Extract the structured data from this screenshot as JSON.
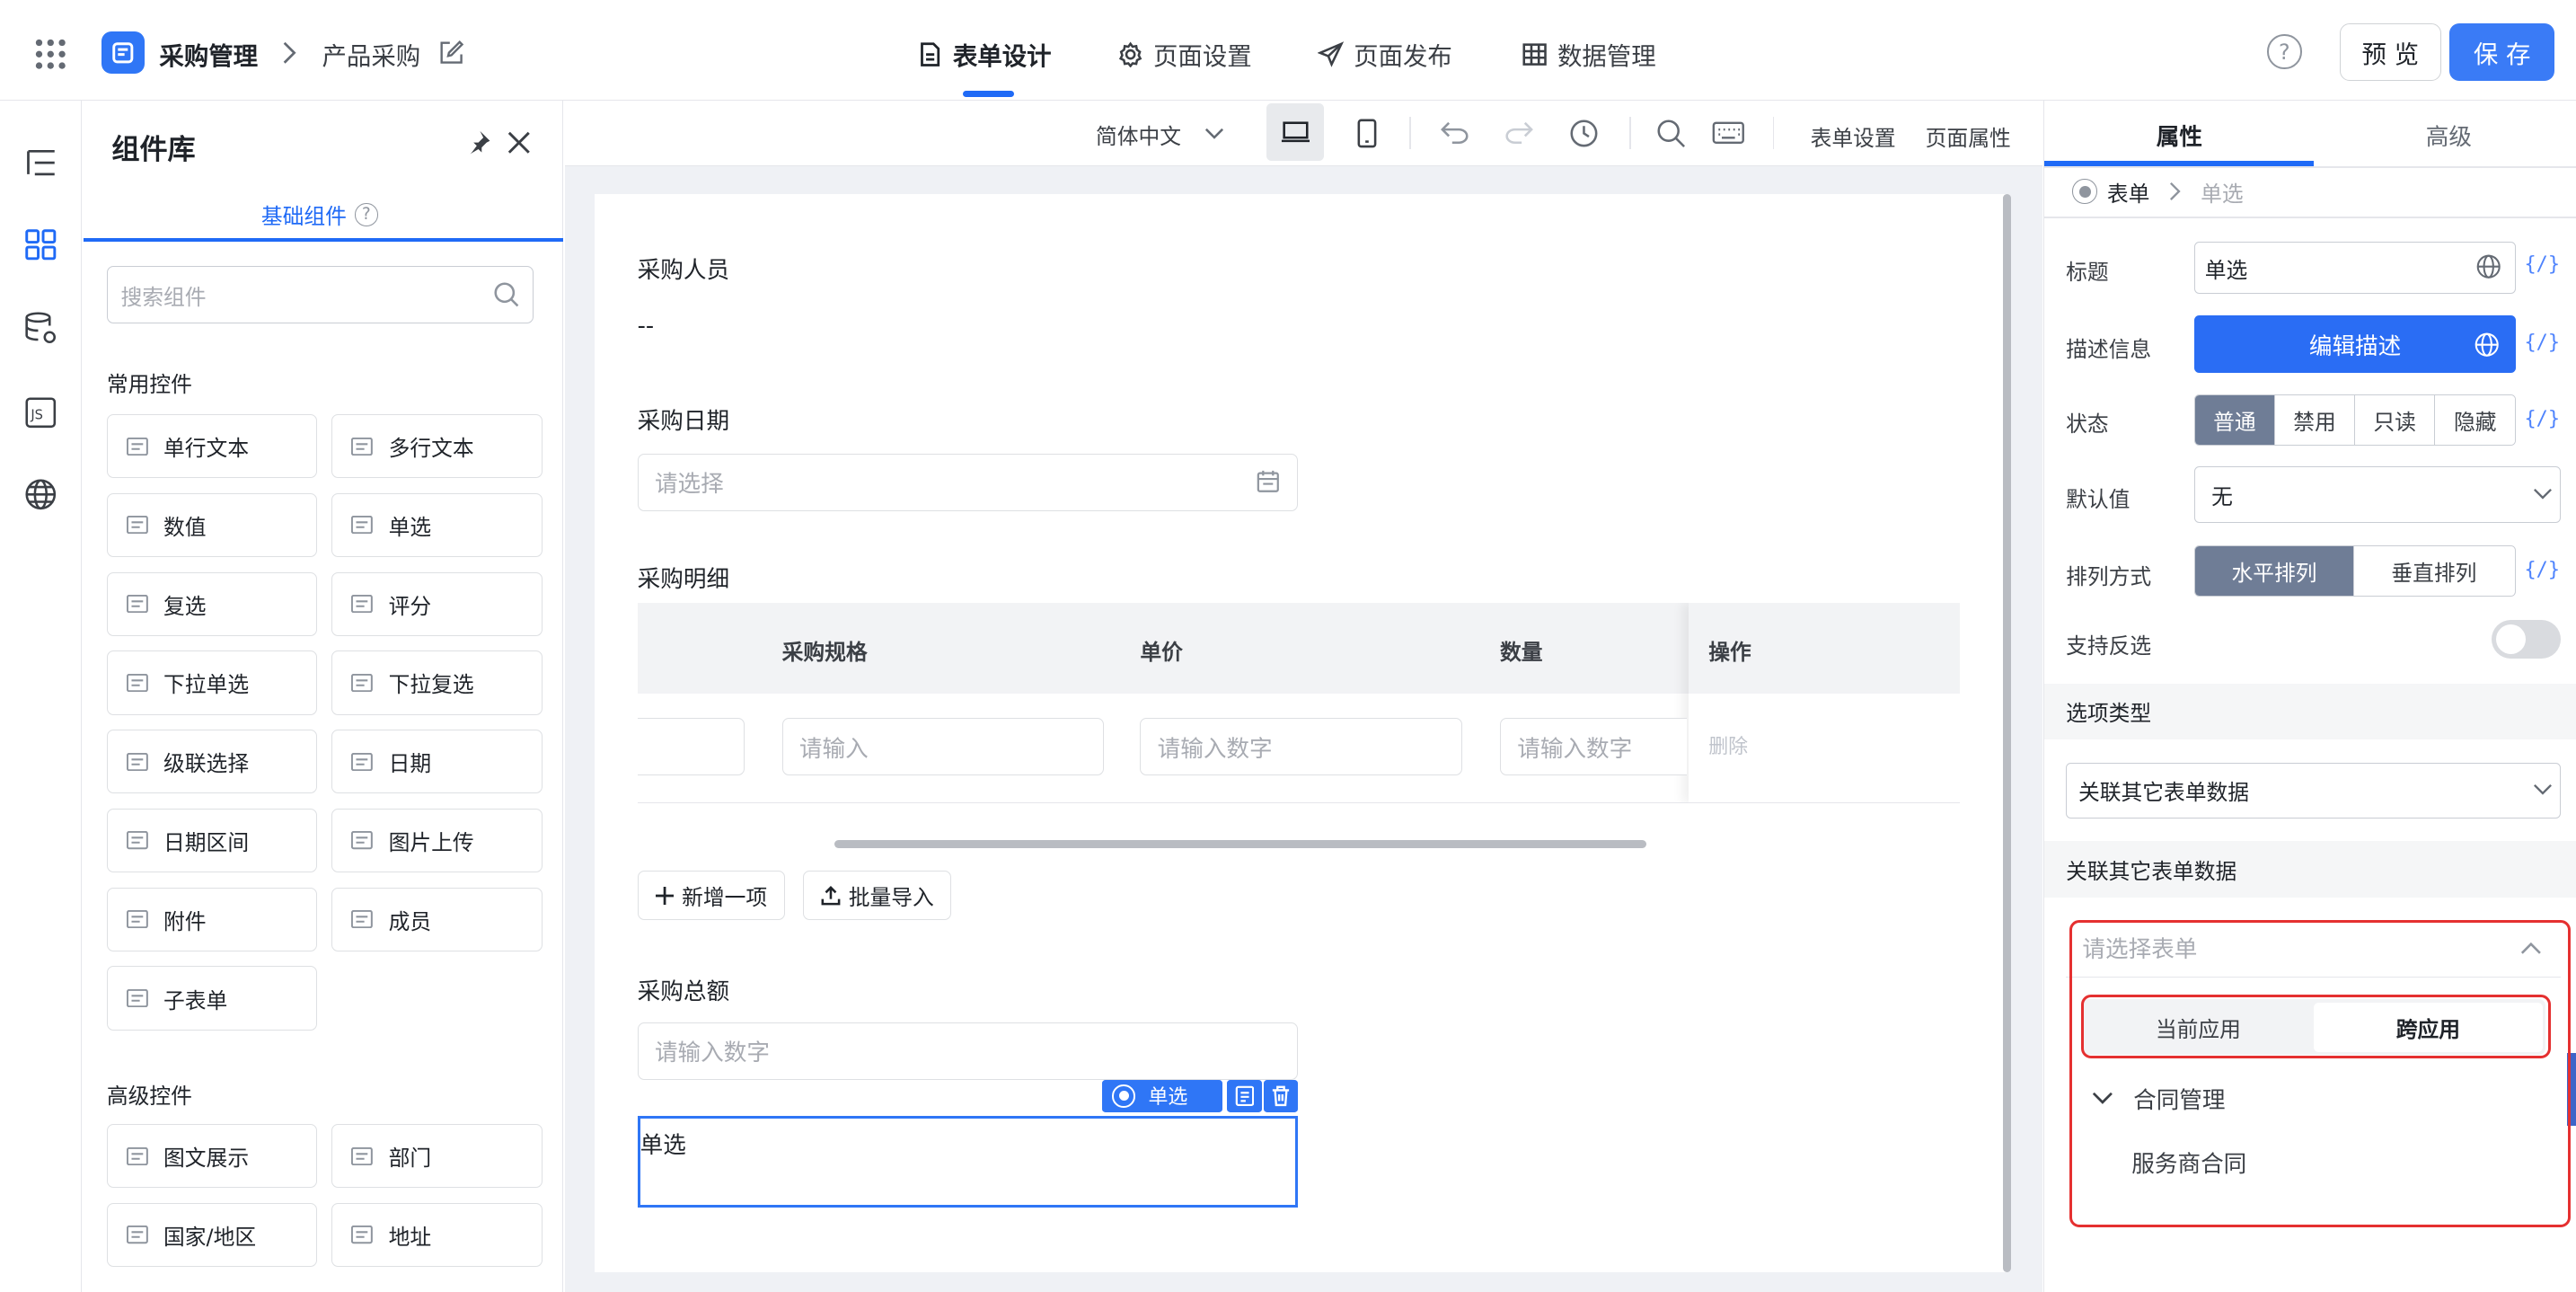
{
  "header": {
    "app_name": "采购管理",
    "page_name": "产品采购",
    "tabs": [
      {
        "label": "表单设计"
      },
      {
        "label": "页面设置"
      },
      {
        "label": "页面发布"
      },
      {
        "label": "数据管理"
      }
    ],
    "preview_label": "预 览",
    "save_label": "保 存",
    "help_icon_text": "?"
  },
  "library": {
    "title": "组件库",
    "tab_label": "基础组件",
    "search_placeholder": "搜索组件",
    "common_title": "常用控件",
    "common": [
      {
        "label": "单行文本",
        "icon": "single-line-icon"
      },
      {
        "label": "多行文本",
        "icon": "multi-line-icon"
      },
      {
        "label": "数值",
        "icon": "number-icon"
      },
      {
        "label": "单选",
        "icon": "radio-icon"
      },
      {
        "label": "复选",
        "icon": "checkbox-icon"
      },
      {
        "label": "评分",
        "icon": "star-icon"
      },
      {
        "label": "下拉单选",
        "icon": "dropdown-icon"
      },
      {
        "label": "下拉复选",
        "icon": "dropdown-multi-icon"
      },
      {
        "label": "级联选择",
        "icon": "cascade-icon"
      },
      {
        "label": "日期",
        "icon": "calendar-icon"
      },
      {
        "label": "日期区间",
        "icon": "date-range-icon"
      },
      {
        "label": "图片上传",
        "icon": "image-icon"
      },
      {
        "label": "附件",
        "icon": "attachment-icon"
      },
      {
        "label": "成员",
        "icon": "user-icon"
      },
      {
        "label": "子表单",
        "icon": "subform-icon"
      }
    ],
    "advanced_title": "高级控件",
    "advanced": [
      {
        "label": "图文展示",
        "icon": "richtext-icon"
      },
      {
        "label": "部门",
        "icon": "department-icon"
      },
      {
        "label": "国家/地区",
        "icon": "globe-icon"
      },
      {
        "label": "地址",
        "icon": "map-icon"
      }
    ]
  },
  "toolbar": {
    "language": "简体中文",
    "form_settings": "表单设置",
    "page_props": "页面属性"
  },
  "form": {
    "fields": [
      {
        "label": "采购人员",
        "value": "--"
      },
      {
        "label": "采购日期",
        "placeholder": "请选择"
      },
      {
        "label": "采购明细"
      },
      {
        "label": "采购总额",
        "placeholder": "请输入数字"
      }
    ],
    "table": {
      "columns": [
        "采购规格",
        "单价",
        "数量",
        "操作"
      ],
      "row": {
        "input1": "请输入",
        "input2": "请输入数字",
        "input3": "请输入数字",
        "action": "删除"
      }
    },
    "add_item": "新增一项",
    "batch_import": "批量导入",
    "selected_tag": "单选",
    "selected_field_label": "单选"
  },
  "properties": {
    "tabs": [
      "属性",
      "高级"
    ],
    "breadcrumb": [
      "表单",
      "单选"
    ],
    "title_label": "标题",
    "title_value": "单选",
    "desc_label": "描述信息",
    "desc_button": "编辑描述",
    "state_label": "状态",
    "states": [
      "普通",
      "禁用",
      "只读",
      "隐藏"
    ],
    "default_label": "默认值",
    "default_value": "无",
    "layout_label": "排列方式",
    "layouts": [
      "水平排列",
      "垂直排列"
    ],
    "invert_label": "支持反选",
    "fx": "{/}",
    "option_type_section": "选项类型",
    "option_type_value": "关联其它表单数据",
    "related_section": "关联其它表单数据",
    "select_form_placeholder": "请选择表单",
    "app_tabs": [
      "当前应用",
      "跨应用"
    ],
    "tree": {
      "group": "合同管理",
      "item": "服务商合同"
    }
  },
  "colors": {
    "accent": "#1f6af6",
    "highlight": "#e53030"
  }
}
